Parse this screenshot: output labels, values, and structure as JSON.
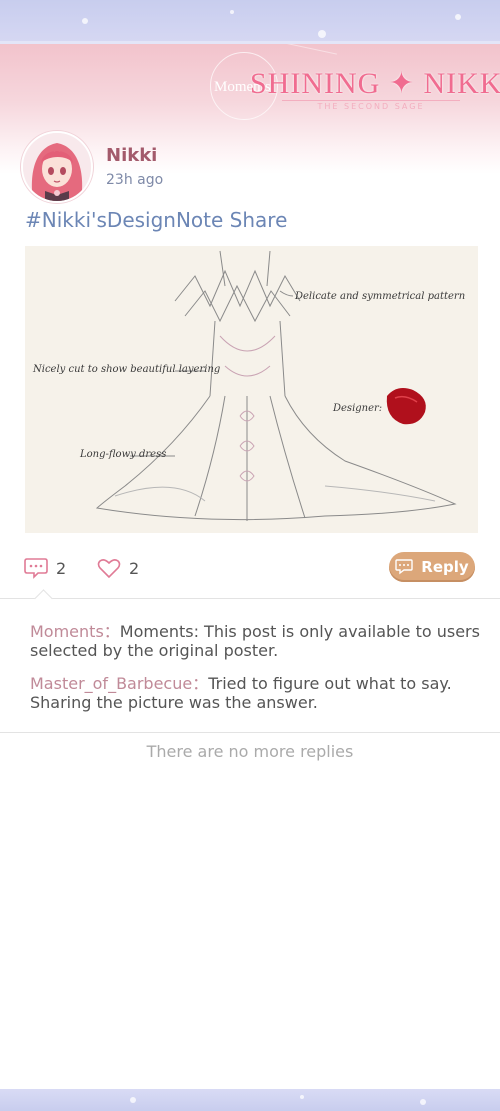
{
  "header": {
    "logo_moments": "Moments",
    "logo_title": "SHINING ✦ NIKKI",
    "logo_subtitle": "THE SECOND SAGE",
    "accent_color": "#f06c90"
  },
  "post": {
    "user_name": "Nikki",
    "time": "23h ago",
    "text": "#Nikki'sDesignNote Share",
    "image_labels": {
      "pattern": "Delicate and symmetrical pattern",
      "layering": "Nicely cut to show beautiful layering",
      "designer": "Designer:",
      "dress": "Long-flowy dress"
    },
    "comment_count": "2",
    "like_count": "2",
    "reply_label": "Reply",
    "reply_color": "#dca77a"
  },
  "comments": [
    {
      "author": "Moments",
      "separator": "：",
      "text": "Moments: This post is only available to users selected by the original poster."
    },
    {
      "author": "Master_of_Barbecue",
      "separator": "：",
      "text": "Tried to figure out what to say. Sharing the picture was the answer."
    }
  ],
  "footer": {
    "no_more": "There are no more replies"
  }
}
